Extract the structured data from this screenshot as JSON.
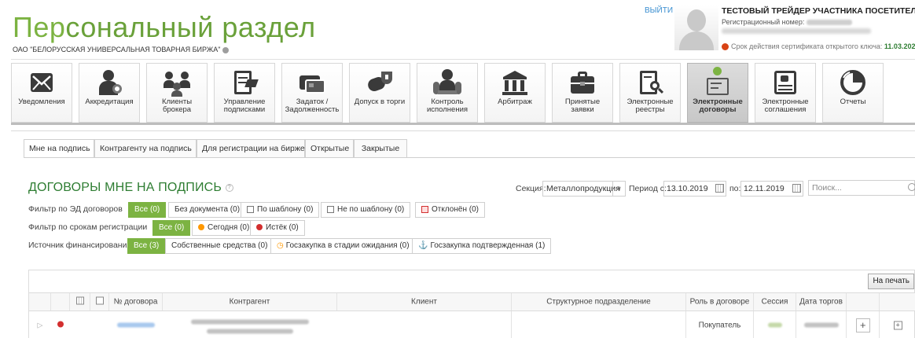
{
  "header": {
    "title_part1": "Пер",
    "title_part2": "сональный раздел",
    "org": "ОАО \"БЕЛОРУССКАЯ УНИВЕРСАЛЬНАЯ ТОВАРНАЯ БИРЖА\"",
    "logout": "ВЫЙТИ",
    "user_name": "ТЕСТОВЫЙ ТРЕЙДЕР УЧАСТНИКА ПОСЕТИТЕЛЯ",
    "reg_label": "Регистрационный номер:",
    "cert_label": "Срок действия сертификата открытого ключа:",
    "cert_date": "11.03.202"
  },
  "toolbar": {
    "items": [
      {
        "label": "Уведомления",
        "icon": "envelope-icon"
      },
      {
        "label": "Аккредитация",
        "icon": "person-gear-icon"
      },
      {
        "label": "Клиенты брокера",
        "icon": "people-icon"
      },
      {
        "label": "Управление подписками",
        "icon": "edit-document-icon"
      },
      {
        "label": "Задаток / Задолженность",
        "icon": "cards-icon"
      },
      {
        "label": "Допуск в торги",
        "icon": "handshake-shield-icon"
      },
      {
        "label": "Контроль исполнения",
        "icon": "meeting-icon"
      },
      {
        "label": "Арбитраж",
        "icon": "court-icon"
      },
      {
        "label": "Принятые заявки",
        "icon": "briefcase-icon"
      },
      {
        "label": "Электронные реестры",
        "icon": "registry-search-icon"
      },
      {
        "label": "Электронные договоры",
        "icon": "contract-icon"
      },
      {
        "label": "Электронные соглашения",
        "icon": "agreement-icon"
      },
      {
        "label": "Отчеты",
        "icon": "pie-chart-icon"
      }
    ]
  },
  "tabs": [
    "Мне на подпись",
    "Контрагенту на подпись",
    "Для регистрации на бирже",
    "Открытые",
    "Закрытые"
  ],
  "section_title": "ДОГОВОРЫ МНЕ НА ПОДПИСЬ",
  "filters": {
    "ed": {
      "label": "Фильтр по ЭД договоров",
      "chips": [
        "Все (0)",
        "Без документа (0)",
        "По шаблону (0)",
        "Не по шаблону (0)",
        "Отклонён (0)"
      ]
    },
    "terms": {
      "label": "Фильтр по срокам регистрации",
      "chips": [
        "Все (0)",
        "Сегодня (0)",
        "Истёк (0)"
      ]
    },
    "source": {
      "label": "Источник финансирования",
      "chips": [
        "Все (3)",
        "Собственные средства (0)",
        "Госзакупка в стадии ожидания (0)",
        "Госзакупка подтвержденная (1)"
      ]
    }
  },
  "controls": {
    "section_label": "Секция:",
    "section_value": "Металлопродукция",
    "period_label": "Период с:",
    "date_from": "13.10.2019",
    "to_label": "по:",
    "date_to": "12.11.2019",
    "search_placeholder": "Поиск..."
  },
  "table": {
    "print": "На печать",
    "headers": [
      "№ договора",
      "Контрагент",
      "Клиент",
      "Структурное подразделение",
      "Роль в договоре",
      "Сессия",
      "Дата торгов"
    ],
    "row": {
      "role": "Покупатель"
    }
  },
  "colors": {
    "accent": "#7cb342",
    "title_green": "#2e7d32",
    "status_red": "#d32f2f"
  }
}
